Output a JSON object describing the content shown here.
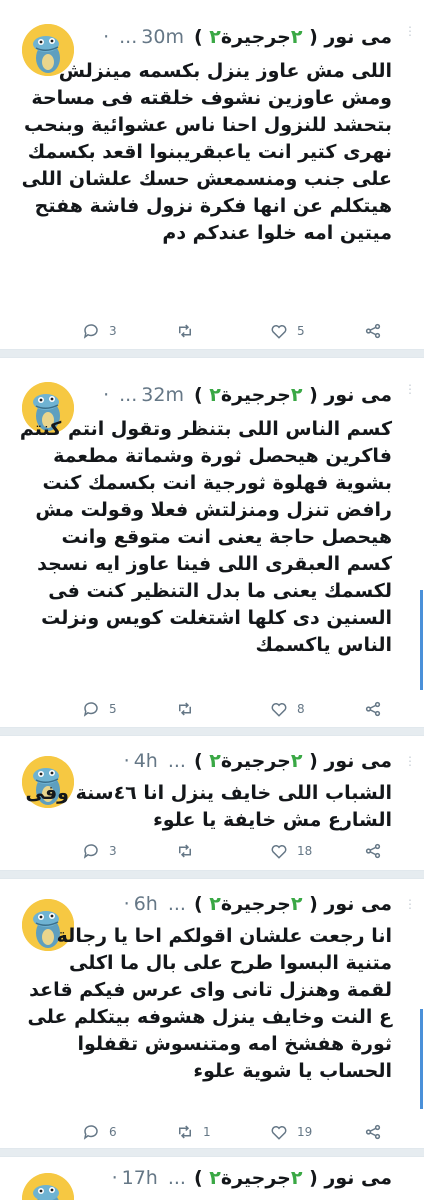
{
  "tweets": [
    {
      "name": "مى نور",
      "handle_suffix": "جرجيرة",
      "time": "30m",
      "handle_prefix": "...",
      "body": "اللى مش عاوز ينزل بكسمه مينزلش ومش عاوزين نشوف خلقته فى مساحة بتحشد للنزول احنا ناس عشوائية وبنحب نهرى كتير انت ياعبقريبنوا اقعد بكسمك على جنب ومنسمعش حسك علشان اللى هيتكلم عن انها فكرة نزول فاشة هفتح ميتين امه خلوا عندكم دم",
      "replies": "3",
      "retweets": "",
      "likes": "5"
    },
    {
      "name": "مى نور",
      "handle_suffix": "جرجيرة",
      "time": "32m",
      "handle_prefix": "...",
      "body": "كسم الناس اللى بتنظر وتقول انتم كنتم فاكرين هيحصل ثورة وشماتة مطعمة بشوية فهلوة ثورجية انت بكسمك كنت رافض تنزل ومنزلتش فعلا وقولت مش هيحصل حاجة يعنى انت متوقع وانت كسم العبقرى اللى فينا عاوز ايه نسجد لكسمك يعنى ما بدل التنظير كنت فى السنين دى كلها اشتغلت كويس ونزلت الناس ياكسمك",
      "replies": "5",
      "retweets": "",
      "likes": "8"
    },
    {
      "name": "مى نور",
      "handle_suffix": "جرجيرة",
      "time": "4h",
      "handle_prefix": "...",
      "body": "الشباب اللى خايف ينزل انا ٤٦سنة وفى الشارع مش خايفة يا علوء",
      "replies": "3",
      "retweets": "",
      "likes": "18"
    },
    {
      "name": "مى نور",
      "handle_suffix": "جرجيرة",
      "time": "6h",
      "handle_prefix": "...",
      "body": "انا رجعت علشان اقولكم احا يا رجالة متنية البسوا طرح على بال ما اكلى لقمة وهنزل تانى واى عرس فيكم قاعد ع النت وخايف ينزل هشوفه بيتكلم على ثورة هفشخ امه ومتنسوش تقفلوا الحساب يا شوية علوء",
      "replies": "6",
      "retweets": "1",
      "likes": "19"
    },
    {
      "name": "مى نور",
      "handle_suffix": "جرجيرة",
      "time": "17h",
      "handle_prefix": "...",
      "body": "",
      "replies": "",
      "retweets": "",
      "likes": ""
    }
  ],
  "icons": {
    "reply": "reply-icon",
    "retweet": "retweet-icon",
    "like": "heart-icon",
    "share": "share-icon",
    "more": "more-vertical-icon",
    "sprout": "sprout-icon"
  },
  "colors": {
    "text": "#14171a",
    "muted": "#657786",
    "separator": "#e6ecf0",
    "thread_line": "#4a90d9",
    "avatar_bg": "#f6c842",
    "sprout": "#3aa845"
  }
}
